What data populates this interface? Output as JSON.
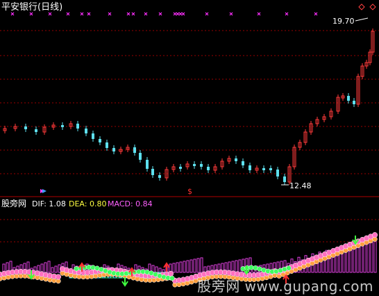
{
  "window": {
    "title": "平安银行(日线)"
  },
  "price_panel": {
    "high_label": "19.70",
    "low_label": "12.48",
    "up_color": "#ff3a3a",
    "down_color": "#5ee0ee",
    "grid_color": "#9a0000"
  },
  "indicator_panel": {
    "name": "股旁网",
    "dif_text": "DIF: 1.08",
    "dea_text": "DEA: 0.80",
    "macd_text": "MACD: 0.84",
    "dif_color": "#ffffff",
    "dea_color": "#ffff40",
    "macd_color": "#ff60ff"
  },
  "watermark": "股旁网 www.gupang.com",
  "icons": {
    "signal_marker": "magenta-x-marker",
    "diamond": "diamond-icon",
    "sell_signal": "dollar-s-icon",
    "buy_arrow": "up-arrow-icon",
    "sell_arrow": "down-arrow-icon"
  }
}
